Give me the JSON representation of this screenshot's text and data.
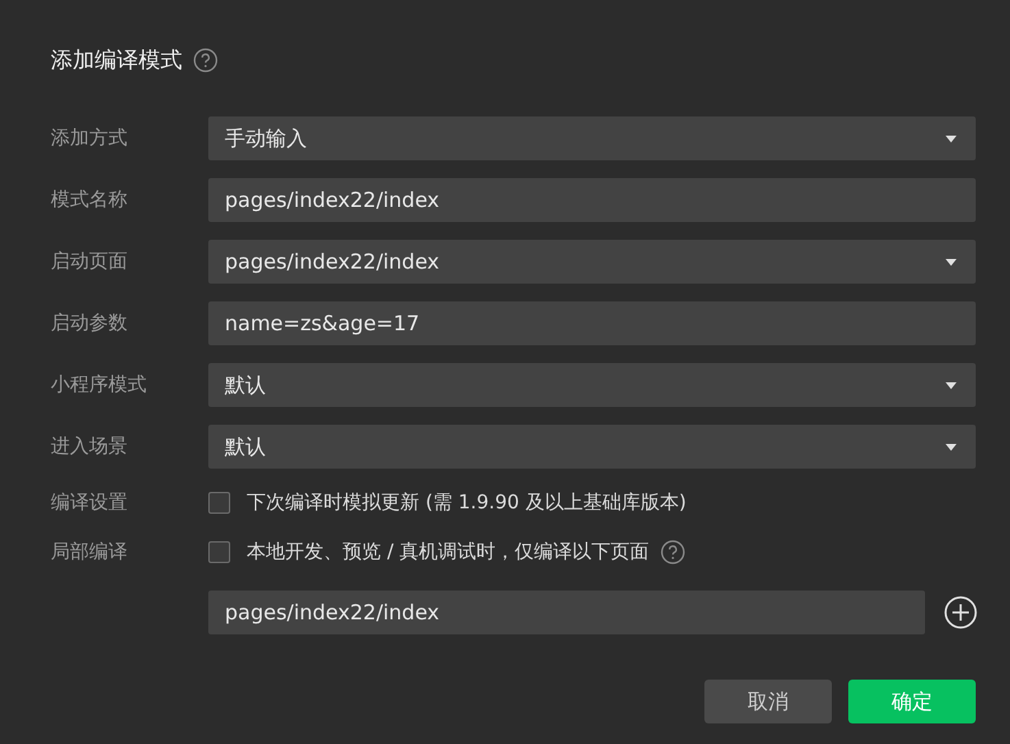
{
  "dialog": {
    "title": "添加编译模式",
    "help": true
  },
  "rows": [
    {
      "kind": "select",
      "label": "添加方式",
      "value": "手动输入"
    },
    {
      "kind": "input",
      "label": "模式名称",
      "value": "pages/index22/index"
    },
    {
      "kind": "select",
      "label": "启动页面",
      "value": "pages/index22/index"
    },
    {
      "kind": "input",
      "label": "启动参数",
      "value": "name=zs&age=17"
    },
    {
      "kind": "select",
      "label": "小程序模式",
      "value": "默认"
    },
    {
      "kind": "select",
      "label": "进入场景",
      "value": "默认"
    },
    {
      "kind": "checkbox",
      "label": "编译设置",
      "text": "下次编译时模拟更新 (需 1.9.90 及以上基础库版本)",
      "checked": false,
      "help": false
    },
    {
      "kind": "checkbox",
      "label": "局部编译",
      "text": "本地开发、预览 / 真机调试时，仅编译以下页面",
      "checked": false,
      "help": true
    }
  ],
  "page_paths": [
    {
      "value": "pages/index22/index"
    }
  ],
  "buttons": [
    {
      "label": "取消",
      "kind": "secondary"
    },
    {
      "label": "确定",
      "kind": "primary"
    }
  ]
}
